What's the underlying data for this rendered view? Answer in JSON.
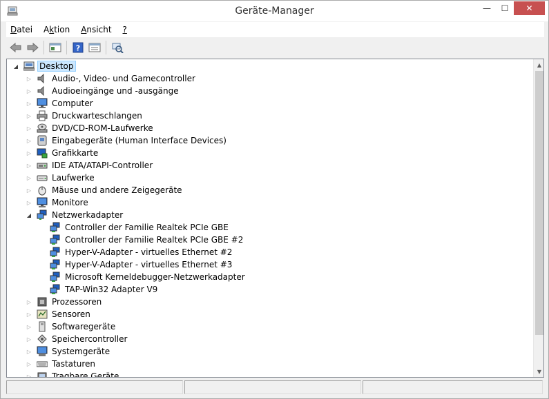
{
  "window": {
    "title": "Geräte-Manager",
    "controls": {
      "minimize": "—",
      "maximize": "☐",
      "close": "✕"
    }
  },
  "menu": [
    {
      "label": "Datei",
      "key": "D"
    },
    {
      "label": "Aktion",
      "key": "k"
    },
    {
      "label": "Ansicht",
      "key": "A"
    },
    {
      "label": "?",
      "key": "?"
    }
  ],
  "toolbar": {
    "buttons": [
      "back-icon",
      "forward-icon",
      "properties-icon",
      "help-icon",
      "view-icon",
      "scan-hardware-icon"
    ]
  },
  "tree": {
    "root": {
      "label": "Desktop",
      "icon": "computer-icon"
    },
    "categories": [
      {
        "label": "Audio-, Video- und Gamecontroller",
        "icon": "speaker-icon",
        "expanded": false
      },
      {
        "label": "Audioeingänge und -ausgänge",
        "icon": "speaker-icon",
        "expanded": false
      },
      {
        "label": "Computer",
        "icon": "monitor-icon",
        "expanded": false
      },
      {
        "label": "Druckwarteschlangen",
        "icon": "printer-icon",
        "expanded": false
      },
      {
        "label": "DVD/CD-ROM-Laufwerke",
        "icon": "optical-drive-icon",
        "expanded": false
      },
      {
        "label": "Eingabegeräte (Human Interface Devices)",
        "icon": "hid-icon",
        "expanded": false
      },
      {
        "label": "Grafikkarte",
        "icon": "display-adapter-icon",
        "expanded": false
      },
      {
        "label": "IDE ATA/ATAPI-Controller",
        "icon": "ide-controller-icon",
        "expanded": false
      },
      {
        "label": "Laufwerke",
        "icon": "disk-drive-icon",
        "expanded": false
      },
      {
        "label": "Mäuse und andere Zeigegeräte",
        "icon": "mouse-icon",
        "expanded": false
      },
      {
        "label": "Monitore",
        "icon": "monitor-icon",
        "expanded": false
      },
      {
        "label": "Netzwerkadapter",
        "icon": "network-icon",
        "expanded": true,
        "children": [
          {
            "label": "Controller der Familie Realtek PCIe GBE",
            "icon": "network-adapter-icon"
          },
          {
            "label": "Controller der Familie Realtek PCIe GBE #2",
            "icon": "network-adapter-icon"
          },
          {
            "label": "Hyper-V-Adapter - virtuelles Ethernet #2",
            "icon": "network-adapter-icon"
          },
          {
            "label": "Hyper-V-Adapter - virtuelles Ethernet #3",
            "icon": "network-adapter-icon"
          },
          {
            "label": "Microsoft Kerneldebugger-Netzwerkadapter",
            "icon": "network-adapter-icon"
          },
          {
            "label": "TAP-Win32 Adapter V9",
            "icon": "network-adapter-icon"
          }
        ]
      },
      {
        "label": "Prozessoren",
        "icon": "processor-icon",
        "expanded": false
      },
      {
        "label": "Sensoren",
        "icon": "sensor-icon",
        "expanded": false
      },
      {
        "label": "Softwaregeräte",
        "icon": "software-device-icon",
        "expanded": false
      },
      {
        "label": "Speichercontroller",
        "icon": "storage-controller-icon",
        "expanded": false
      },
      {
        "label": "Systemgeräte",
        "icon": "system-device-icon",
        "expanded": false
      },
      {
        "label": "Tastaturen",
        "icon": "keyboard-icon",
        "expanded": false
      },
      {
        "label": "Tragbare Geräte",
        "icon": "portable-device-icon",
        "expanded": false
      }
    ]
  },
  "scrollbar": {
    "up": "▲",
    "down": "▼",
    "position": 0
  },
  "colors": {
    "selection_bg": "#cce8ff",
    "selection_border": "#99d1ff",
    "close_button": "#c75050",
    "network_green": "#3aa641",
    "monitor_blue": "#1f5fbf"
  }
}
